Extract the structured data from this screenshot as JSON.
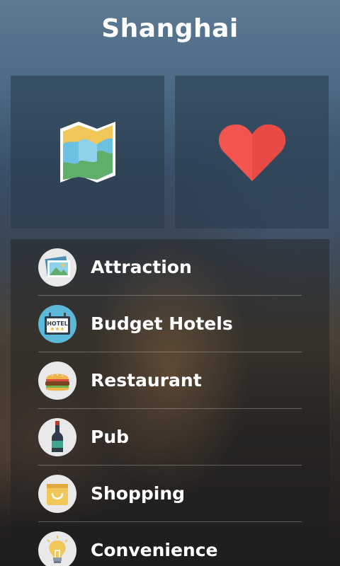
{
  "header": {
    "title": "Shanghai"
  },
  "tiles": [
    {
      "label": "map",
      "icon": "map-icon"
    },
    {
      "label": "favorites",
      "icon": "heart-icon"
    }
  ],
  "menu": {
    "items": [
      {
        "label": "Attraction",
        "icon": "picture-icon",
        "icon_bg": "#e9e9e9"
      },
      {
        "label": "Budget Hotels",
        "icon": "hotel-sign-icon",
        "icon_bg": "#5bb8d8"
      },
      {
        "label": "Restaurant",
        "icon": "burger-icon",
        "icon_bg": "#e9e9e9"
      },
      {
        "label": "Pub",
        "icon": "wine-bottle-icon",
        "icon_bg": "#e9e9e9"
      },
      {
        "label": "Shopping",
        "icon": "shopping-bag-icon",
        "icon_bg": "#e9e9e9"
      },
      {
        "label": "Convenience",
        "icon": "lightbulb-icon",
        "icon_bg": "#e9e9e9"
      }
    ]
  },
  "icon_texts": {
    "hotel_sign": "HOTEL"
  },
  "colors": {
    "heart": "#f25550",
    "map_blue": "#6cc0e0",
    "map_green": "#5fae6a",
    "map_yellow": "#f1c75a"
  }
}
